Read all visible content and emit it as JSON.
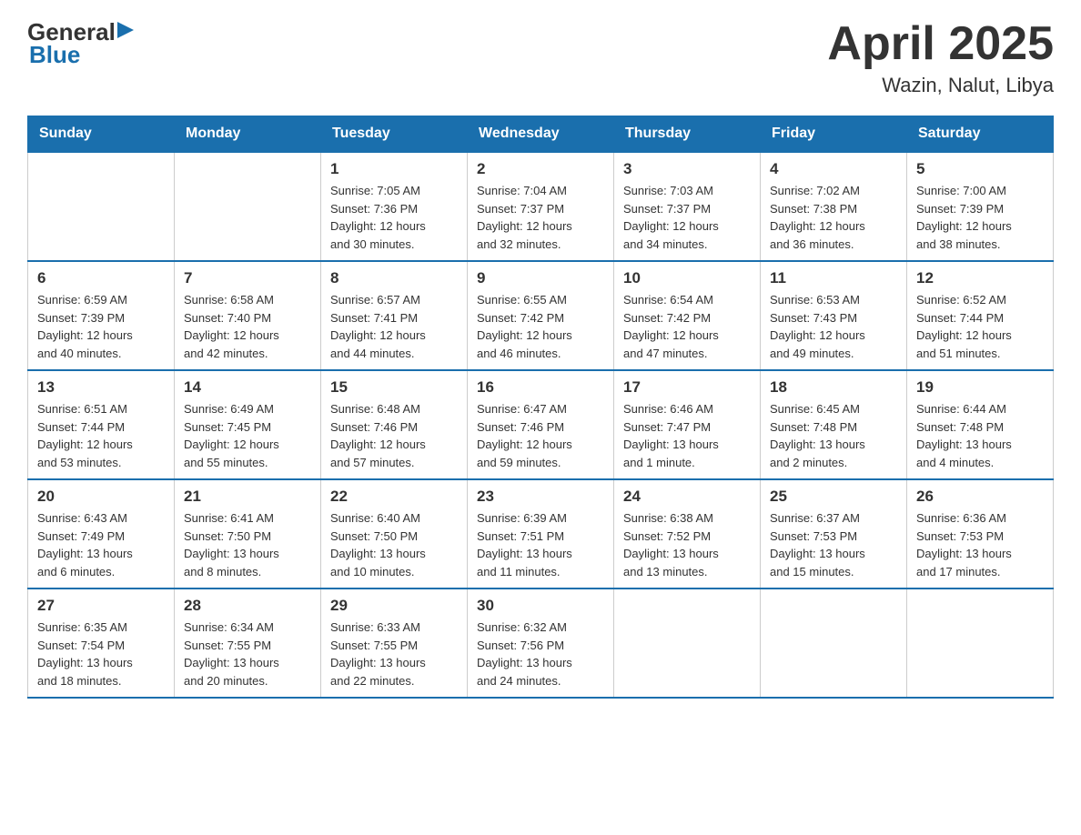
{
  "header": {
    "logo_general": "General",
    "logo_blue": "Blue",
    "month": "April 2025",
    "location": "Wazin, Nalut, Libya"
  },
  "days_of_week": [
    "Sunday",
    "Monday",
    "Tuesday",
    "Wednesday",
    "Thursday",
    "Friday",
    "Saturday"
  ],
  "weeks": [
    [
      {
        "day": "",
        "info": ""
      },
      {
        "day": "",
        "info": ""
      },
      {
        "day": "1",
        "info": "Sunrise: 7:05 AM\nSunset: 7:36 PM\nDaylight: 12 hours\nand 30 minutes."
      },
      {
        "day": "2",
        "info": "Sunrise: 7:04 AM\nSunset: 7:37 PM\nDaylight: 12 hours\nand 32 minutes."
      },
      {
        "day": "3",
        "info": "Sunrise: 7:03 AM\nSunset: 7:37 PM\nDaylight: 12 hours\nand 34 minutes."
      },
      {
        "day": "4",
        "info": "Sunrise: 7:02 AM\nSunset: 7:38 PM\nDaylight: 12 hours\nand 36 minutes."
      },
      {
        "day": "5",
        "info": "Sunrise: 7:00 AM\nSunset: 7:39 PM\nDaylight: 12 hours\nand 38 minutes."
      }
    ],
    [
      {
        "day": "6",
        "info": "Sunrise: 6:59 AM\nSunset: 7:39 PM\nDaylight: 12 hours\nand 40 minutes."
      },
      {
        "day": "7",
        "info": "Sunrise: 6:58 AM\nSunset: 7:40 PM\nDaylight: 12 hours\nand 42 minutes."
      },
      {
        "day": "8",
        "info": "Sunrise: 6:57 AM\nSunset: 7:41 PM\nDaylight: 12 hours\nand 44 minutes."
      },
      {
        "day": "9",
        "info": "Sunrise: 6:55 AM\nSunset: 7:42 PM\nDaylight: 12 hours\nand 46 minutes."
      },
      {
        "day": "10",
        "info": "Sunrise: 6:54 AM\nSunset: 7:42 PM\nDaylight: 12 hours\nand 47 minutes."
      },
      {
        "day": "11",
        "info": "Sunrise: 6:53 AM\nSunset: 7:43 PM\nDaylight: 12 hours\nand 49 minutes."
      },
      {
        "day": "12",
        "info": "Sunrise: 6:52 AM\nSunset: 7:44 PM\nDaylight: 12 hours\nand 51 minutes."
      }
    ],
    [
      {
        "day": "13",
        "info": "Sunrise: 6:51 AM\nSunset: 7:44 PM\nDaylight: 12 hours\nand 53 minutes."
      },
      {
        "day": "14",
        "info": "Sunrise: 6:49 AM\nSunset: 7:45 PM\nDaylight: 12 hours\nand 55 minutes."
      },
      {
        "day": "15",
        "info": "Sunrise: 6:48 AM\nSunset: 7:46 PM\nDaylight: 12 hours\nand 57 minutes."
      },
      {
        "day": "16",
        "info": "Sunrise: 6:47 AM\nSunset: 7:46 PM\nDaylight: 12 hours\nand 59 minutes."
      },
      {
        "day": "17",
        "info": "Sunrise: 6:46 AM\nSunset: 7:47 PM\nDaylight: 13 hours\nand 1 minute."
      },
      {
        "day": "18",
        "info": "Sunrise: 6:45 AM\nSunset: 7:48 PM\nDaylight: 13 hours\nand 2 minutes."
      },
      {
        "day": "19",
        "info": "Sunrise: 6:44 AM\nSunset: 7:48 PM\nDaylight: 13 hours\nand 4 minutes."
      }
    ],
    [
      {
        "day": "20",
        "info": "Sunrise: 6:43 AM\nSunset: 7:49 PM\nDaylight: 13 hours\nand 6 minutes."
      },
      {
        "day": "21",
        "info": "Sunrise: 6:41 AM\nSunset: 7:50 PM\nDaylight: 13 hours\nand 8 minutes."
      },
      {
        "day": "22",
        "info": "Sunrise: 6:40 AM\nSunset: 7:50 PM\nDaylight: 13 hours\nand 10 minutes."
      },
      {
        "day": "23",
        "info": "Sunrise: 6:39 AM\nSunset: 7:51 PM\nDaylight: 13 hours\nand 11 minutes."
      },
      {
        "day": "24",
        "info": "Sunrise: 6:38 AM\nSunset: 7:52 PM\nDaylight: 13 hours\nand 13 minutes."
      },
      {
        "day": "25",
        "info": "Sunrise: 6:37 AM\nSunset: 7:53 PM\nDaylight: 13 hours\nand 15 minutes."
      },
      {
        "day": "26",
        "info": "Sunrise: 6:36 AM\nSunset: 7:53 PM\nDaylight: 13 hours\nand 17 minutes."
      }
    ],
    [
      {
        "day": "27",
        "info": "Sunrise: 6:35 AM\nSunset: 7:54 PM\nDaylight: 13 hours\nand 18 minutes."
      },
      {
        "day": "28",
        "info": "Sunrise: 6:34 AM\nSunset: 7:55 PM\nDaylight: 13 hours\nand 20 minutes."
      },
      {
        "day": "29",
        "info": "Sunrise: 6:33 AM\nSunset: 7:55 PM\nDaylight: 13 hours\nand 22 minutes."
      },
      {
        "day": "30",
        "info": "Sunrise: 6:32 AM\nSunset: 7:56 PM\nDaylight: 13 hours\nand 24 minutes."
      },
      {
        "day": "",
        "info": ""
      },
      {
        "day": "",
        "info": ""
      },
      {
        "day": "",
        "info": ""
      }
    ]
  ]
}
